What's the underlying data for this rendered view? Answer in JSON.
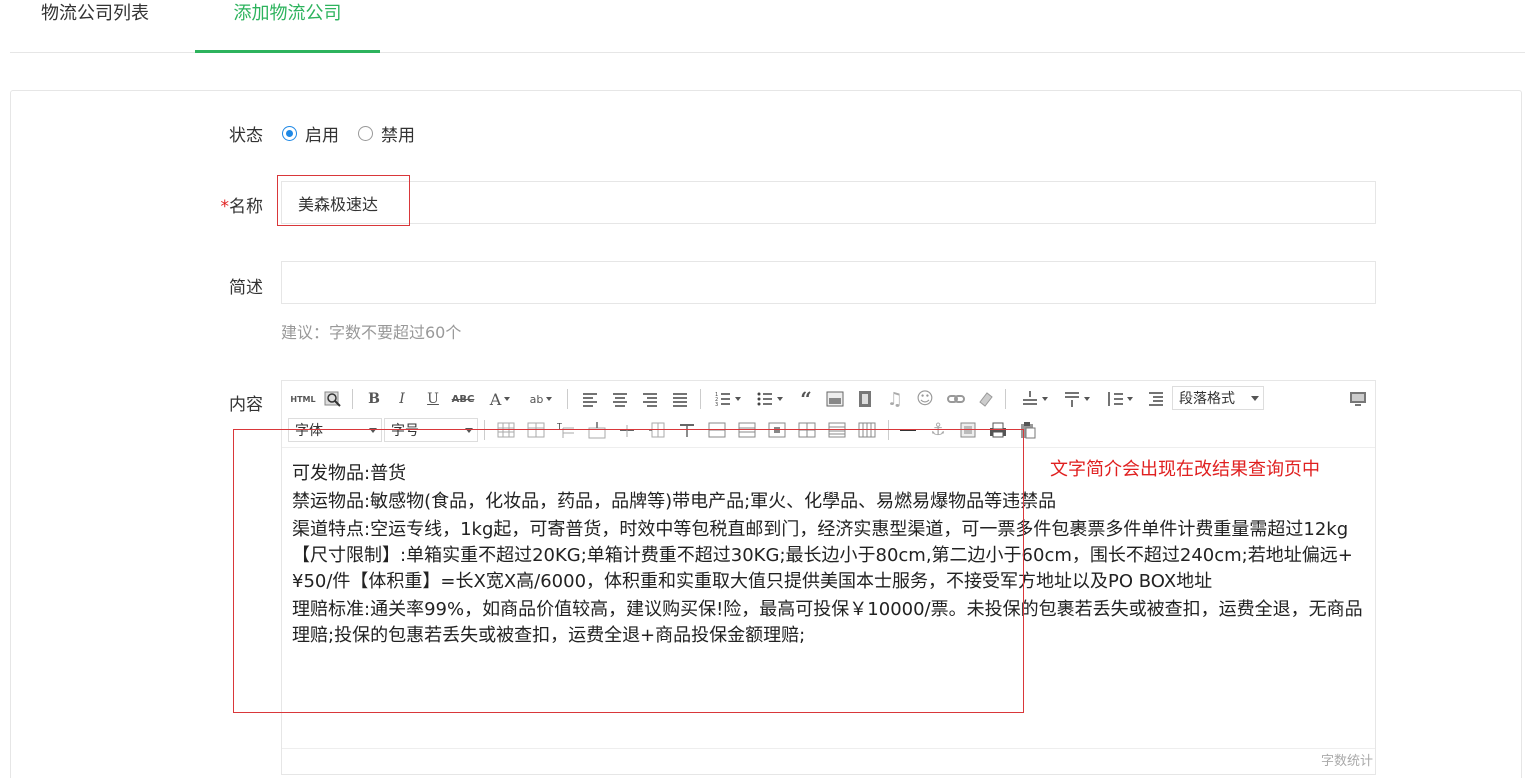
{
  "tabs": [
    {
      "label": "物流公司列表"
    },
    {
      "label": "添加物流公司"
    }
  ],
  "form": {
    "status": {
      "label": "状态",
      "options": [
        {
          "label": "启用",
          "checked": true
        },
        {
          "label": "禁用",
          "checked": false
        }
      ]
    },
    "name": {
      "required_mark": "*",
      "label": "名称",
      "value": "美森极速达"
    },
    "summary": {
      "label": "简述",
      "value": "",
      "hint": "建议：字数不要超过60个"
    },
    "content": {
      "label": "内容"
    }
  },
  "editor": {
    "paragraph_format": "段落格式",
    "font_family": "字体",
    "font_size": "字号",
    "paragraphs": [
      "可发物品:普货",
      "禁运物品:敏感物(食品，化妆品，药品，品牌等)带电产品;軍火、化學品、易燃易爆物品等违禁品",
      "渠道特点:空运专线，1kg起，可寄普货，时效中等包税直邮到门，经济实惠型渠道，可一票多件包裹票多件单件计费重量需超过12kg【尺寸限制】:单箱实重不超过20KG;单箱计费重不超过30KG;最长边小于80cm,第二边小于60cm，围长不超过240cm;若地址偏远+¥50/件【体积重】=长X宽X高/6000，体积重和实重取大值只提供美国本士服务，不接受军方地址以及PO BOX地址",
      "理赔标准:通关率99%，如商品价值较高，建议购买保!险，最高可投保￥10000/票。未投保的包裹若丢失或被查扣，运费全退，无商品理赔;投保的包惠若丢失或被查扣，运费全退+商品投保金额理赔;"
    ],
    "word_count_label": "字数统计"
  },
  "annotation": "文字简介会出现在改结果查询页中",
  "colors": {
    "accent": "#2db35d",
    "radio": "#1e88e5",
    "annotation": "#e02020"
  }
}
